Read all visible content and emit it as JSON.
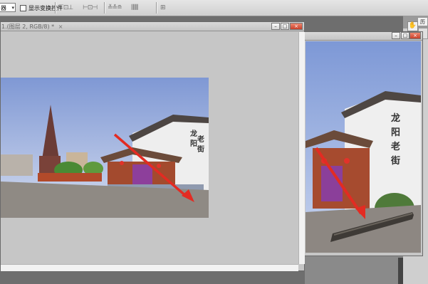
{
  "options_bar": {
    "selector_value": "器",
    "show_transform_controls_label": "显示变换控件"
  },
  "window1": {
    "title": "1.(图层 2, RGB/8) *",
    "close_glyph": "×",
    "controls": {
      "minimize": "–",
      "restore": "□",
      "close": "×"
    }
  },
  "window2": {
    "controls": {
      "minimize": "–",
      "restore": "□",
      "close": "×"
    }
  },
  "right_panel": {
    "tab_label": "历史",
    "tool_glyph": "✋"
  },
  "photo": {
    "sign_text": "龙阳老街",
    "colors": {
      "sky": "#8ea6dc",
      "wall": "#f0f0f0",
      "roof": "#5a4e4a",
      "arrow": "#e32b22"
    }
  }
}
